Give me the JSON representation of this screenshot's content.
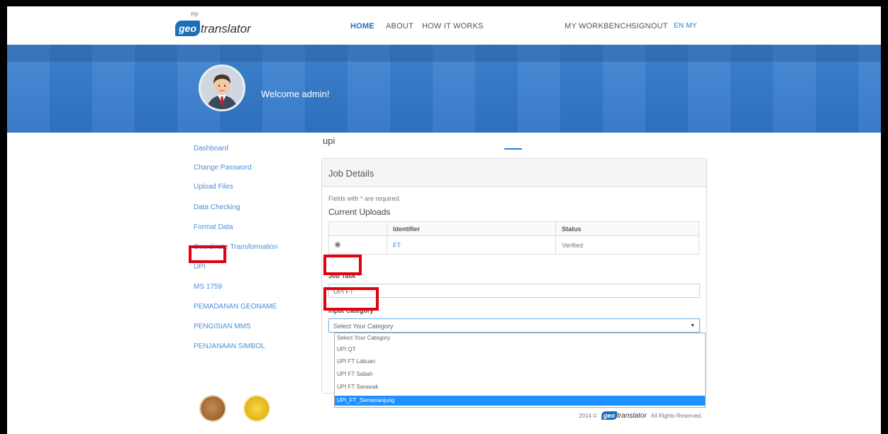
{
  "nav": {
    "logo_my": "my",
    "logo_geo": "geo",
    "logo_trans": "translator",
    "home": "HOME",
    "about": "ABOUT",
    "how": "HOW IT WORKS",
    "workbench": "MY WORKBENCH",
    "signout": "SIGNOUT",
    "lang": "EN MY"
  },
  "banner": {
    "welcome": "Welcome admin!"
  },
  "sidebar": {
    "items": [
      "Dashboard",
      "Change Password",
      "Upload Files",
      "Data Checking",
      "Format Data",
      "Coordinate Transformation",
      "UPI",
      "MS 1759",
      "PEMADANAN GEONAME",
      "PENGISIAN MMS",
      "PENJANAAN SIMBOL"
    ]
  },
  "main": {
    "title": "upi",
    "panel_title": "Job Details",
    "required_note": "Fields with * are required.",
    "uploads_title": "Current Uploads",
    "table": {
      "headers": [
        "",
        "Identifier",
        "Status"
      ],
      "rows": [
        {
          "identifier": "FT",
          "status": "Verified"
        }
      ]
    },
    "job_task_label": "Job Task *",
    "job_task_value": "UPI FT",
    "input_category_label": "Input Category",
    "input_category_value": "Select Your Category",
    "options": [
      "Select Your Category",
      "UPI QT",
      "UPI FT Labuan",
      "UPI FT Sabah",
      "UPI FT Sarawak",
      "UPI_FT_Semenanjung"
    ],
    "selected_option": "UPI_FT_Semenanjung"
  },
  "footer": {
    "year": "2014 ©",
    "logo_geo": "geo",
    "logo_trans": "translator",
    "rights": "All Rights Reserved."
  },
  "colors": {
    "accent": "#2a7fd6",
    "banner": "#3a80cf",
    "highlight": "#e3000f",
    "selected": "#1e90ff"
  }
}
